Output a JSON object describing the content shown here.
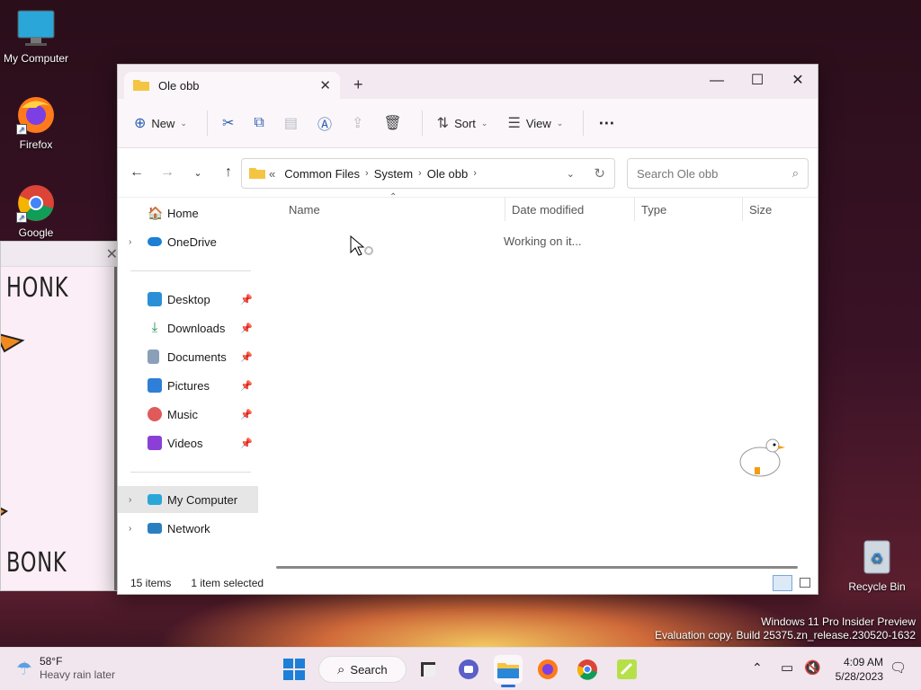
{
  "desktop": {
    "icons": [
      {
        "label": "My Computer"
      },
      {
        "label": "Firefox"
      },
      {
        "label": "Google"
      },
      {
        "label": "Recycle Bin"
      }
    ]
  },
  "goose_window": {
    "top_text": "HONK",
    "bottom_text": "BONK"
  },
  "explorer": {
    "tab_title": "Ole obb",
    "toolbar": {
      "new_label": "New",
      "sort_label": "Sort",
      "view_label": "View",
      "more_label": "⋯"
    },
    "breadcrumb": {
      "overflow": "«",
      "items": [
        "Common Files",
        "System",
        "Ole obb"
      ]
    },
    "search_placeholder": "Search Ole obb",
    "sidebar": {
      "items": [
        {
          "label": "Home"
        },
        {
          "label": "OneDrive"
        },
        {
          "label": "Desktop"
        },
        {
          "label": "Downloads"
        },
        {
          "label": "Documents"
        },
        {
          "label": "Pictures"
        },
        {
          "label": "Music"
        },
        {
          "label": "Videos"
        },
        {
          "label": "My Computer"
        },
        {
          "label": "Network"
        }
      ]
    },
    "columns": [
      "Name",
      "Date modified",
      "Type",
      "Size"
    ],
    "loading_text": "Working on it...",
    "status": {
      "items": "15 items",
      "selected": "1 item selected"
    }
  },
  "taskbar": {
    "weather_temp": "58°F",
    "weather_desc": "Heavy rain later",
    "search_label": "Search",
    "time": "4:09 AM",
    "date": "5/28/2023"
  },
  "watermark": {
    "line1": "Windows 11 Pro Insider Preview",
    "line2": "Evaluation copy. Build 25375.zn_release.230520-1632"
  },
  "colors": {
    "accent": "#2c5fb3",
    "folder": "#f4c542"
  }
}
